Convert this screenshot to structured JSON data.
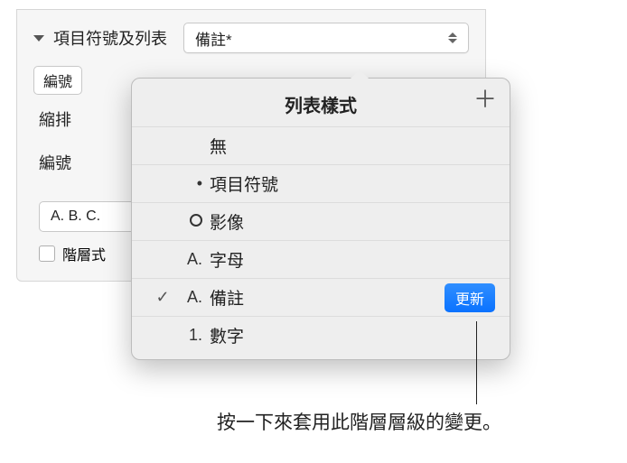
{
  "section": {
    "title": "項目符號及列表",
    "main_dropdown": "備註*",
    "numbering_dropdown": "編號",
    "indent_label": "縮排",
    "numbering_label": "編號",
    "abc_dropdown": "A. B. C.",
    "hierarchy_checkbox_label": "階層式"
  },
  "popover": {
    "title": "列表樣式",
    "items": [
      {
        "marker": "",
        "label": "無",
        "checked": false
      },
      {
        "marker": "•",
        "label": "項目符號",
        "checked": false
      },
      {
        "marker": "◯",
        "label": "影像",
        "checked": false
      },
      {
        "marker": "A.",
        "label": "字母",
        "checked": false
      },
      {
        "marker": "A.",
        "label": "備註",
        "checked": true,
        "update": true
      },
      {
        "marker": "1.",
        "label": "數字",
        "checked": false
      }
    ],
    "update_label": "更新"
  },
  "callout": "按一下來套用此階層層級的變更。"
}
